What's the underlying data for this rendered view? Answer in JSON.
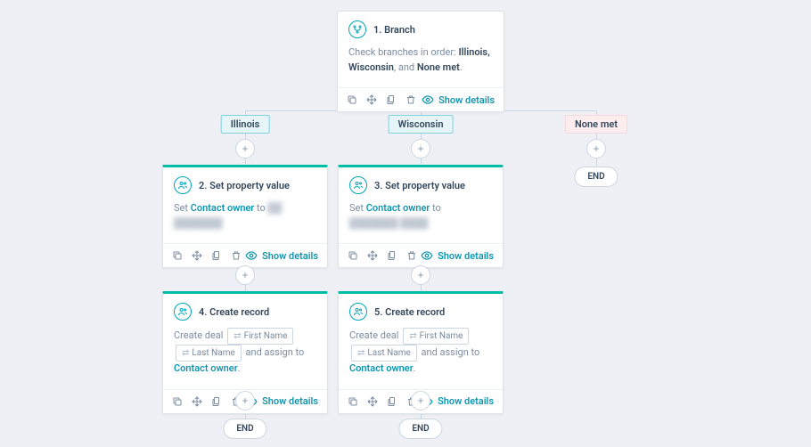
{
  "colors": {
    "accent": "#00bda5",
    "link": "#0091ae",
    "bg": "#eef0f5"
  },
  "end_label": "END",
  "tokens": {
    "first_name": "First Name",
    "last_name": "Last Name"
  },
  "footer": {
    "show_details": "Show details"
  },
  "branches": {
    "b1": {
      "label": "Illinois",
      "type": "match"
    },
    "b2": {
      "label": "Wisconsin",
      "type": "match"
    },
    "b3": {
      "label": "None met",
      "type": "none"
    }
  },
  "cards": {
    "root": {
      "step": "1.",
      "title": "Branch",
      "body_prefix": "Check branches in order: ",
      "body_strong_list": "Illinois, Wisconsin",
      "body_joiner": ", and ",
      "body_strong_tail": "None met",
      "body_suffix": "."
    },
    "c2": {
      "step": "2.",
      "title": "Set property value",
      "line_prefix": "Set ",
      "link": "Contact owner",
      "line_mid": " to ",
      "blurred": "██ ███████"
    },
    "c3": {
      "step": "3.",
      "title": "Set property value",
      "line_prefix": "Set ",
      "link": "Contact owner",
      "line_mid": " to ",
      "blurred": "███████ ████"
    },
    "c4": {
      "step": "4.",
      "title": "Create record",
      "prefix": "Create deal ",
      "mid": " and assign to ",
      "link": "Contact owner",
      "suffix": "."
    },
    "c5": {
      "step": "5.",
      "title": "Create record",
      "prefix": "Create deal ",
      "mid": " and assign to ",
      "link": "Contact owner",
      "suffix": "."
    }
  }
}
